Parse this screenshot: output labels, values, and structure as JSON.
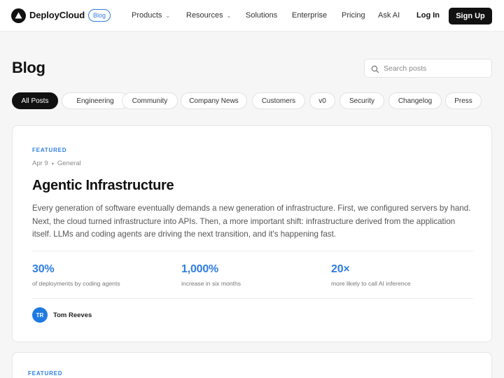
{
  "header": {
    "brand": "DeployCloud",
    "badge": "Blog",
    "nav": [
      {
        "label": "Products",
        "has_dropdown": true
      },
      {
        "label": "Resources",
        "has_dropdown": true
      },
      {
        "label": "Solutions",
        "has_dropdown": false
      },
      {
        "label": "Enterprise",
        "has_dropdown": false
      },
      {
        "label": "Pricing",
        "has_dropdown": false
      },
      {
        "label": "Ask AI",
        "has_dropdown": false
      }
    ],
    "login": "Log In",
    "signup": "Sign Up"
  },
  "page": {
    "title": "Blog",
    "search_placeholder": "Search posts"
  },
  "filters": {
    "items": [
      "All Posts",
      "Engineering",
      "Community",
      "Company News",
      "Customers",
      "v0",
      "Security",
      "Changelog",
      "Press"
    ],
    "active": "All Posts"
  },
  "featured_post": {
    "tag": "FEATURED",
    "date": "Apr 9",
    "category": "General",
    "title": "Agentic Infrastructure",
    "description": "Every generation of software eventually demands a new generation of infrastructure. First, we configured servers by hand. Next, the cloud turned infrastructure into APIs. Then, a more important shift: infrastructure derived from the application itself. LLMs and coding agents are driving the next transition, and it's happening fast.",
    "stats": [
      {
        "value": "30%",
        "label": "of deployments by coding agents"
      },
      {
        "value": "1,000%",
        "label": "increase in six months"
      },
      {
        "value": "20×",
        "label": "more likely to call AI inference"
      }
    ],
    "author": {
      "initials": "TR",
      "name": "Tom Reeves"
    }
  },
  "second_post": {
    "tag": "FEATURED"
  },
  "colors": {
    "accent": "#2f7de1",
    "dark": "#111111",
    "background": "#f6f6f7",
    "avatar": "#1f7ae0"
  },
  "icons": {
    "logo": "triangle-logo-icon",
    "search": "search-icon",
    "dropdown": "chevron-down-icon"
  }
}
